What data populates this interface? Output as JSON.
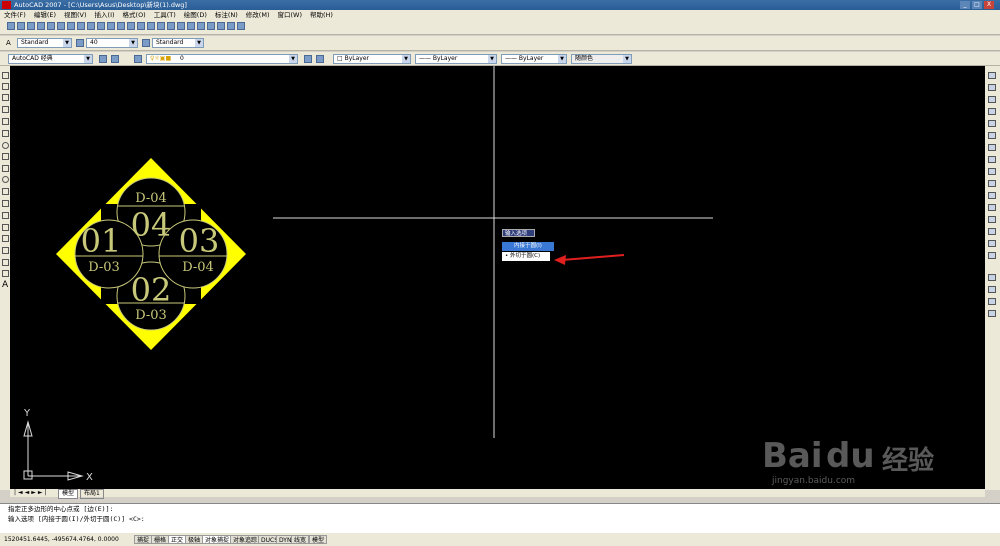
{
  "window": {
    "title": "AutoCAD 2007 - [C:\\Users\\Asus\\Desktop\\新块(1).dwg]",
    "min": "_",
    "max": "□",
    "close": "X"
  },
  "menu": [
    "文件(F)",
    "编辑(E)",
    "视图(V)",
    "插入(I)",
    "格式(O)",
    "工具(T)",
    "绘图(D)",
    "标注(N)",
    "修改(M)",
    "窗口(W)",
    "帮助(H)"
  ],
  "toolbar2": {
    "text_style": "Standard",
    "text_height": "40",
    "dim_style": "Standard"
  },
  "toolbar3": {
    "workspace": "AutoCAD 经典",
    "layer": "0",
    "color": "ByLayer",
    "linetype": "ByLayer",
    "lineweight": "ByLayer",
    "plotstyle": "随颜色"
  },
  "drawing": {
    "labels": [
      "D-04",
      "04",
      "01",
      "03",
      "D-03",
      "D-04",
      "02",
      "D-03"
    ],
    "colors": {
      "fill": "#ffff00",
      "line": "#c8c87a",
      "text": "#c8c87a"
    }
  },
  "popup": {
    "title": "输入选项",
    "option1": "内接于圆(I)",
    "option2": "外切于圆(C)"
  },
  "ucs": {
    "x": "X",
    "y": "Y"
  },
  "tabs": {
    "model": "模型",
    "layout": "布局1"
  },
  "command": {
    "line1": "指定正多边形的中心点或 [边(E)]:",
    "line2": "输入选项 [内接于圆(I)/外切于圆(C)] <C>:"
  },
  "status": {
    "coords": "1520451.6445, -495674.4764, 0.0000",
    "buttons": [
      "捕捉",
      "栅格",
      "正交",
      "极轴",
      "对象捕捉",
      "对象追踪",
      "DUCS",
      "DYN",
      "线宽",
      "模型"
    ]
  },
  "watermark": {
    "brand": "Bai",
    "brand2": "du",
    "cn": "经验",
    "url": "jingyan.baidu.com"
  }
}
